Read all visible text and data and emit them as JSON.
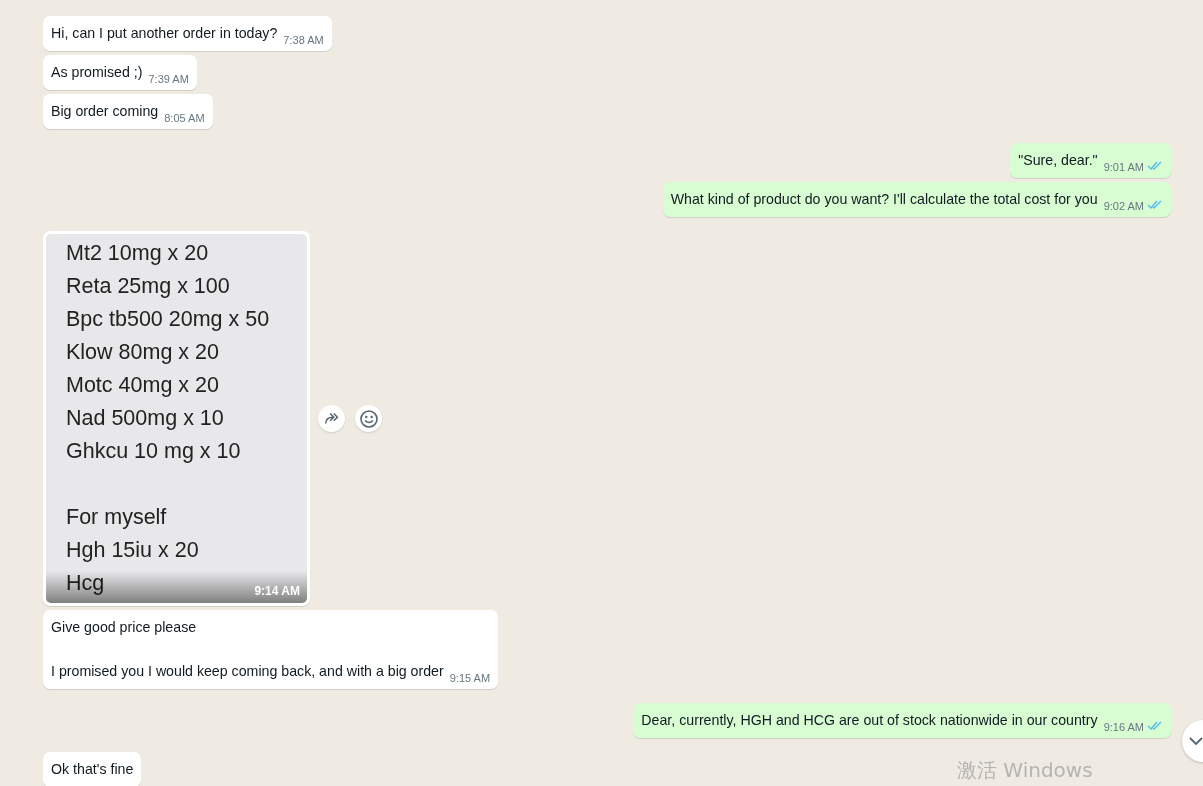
{
  "messages": [
    {
      "outgoing": false,
      "kind": "text",
      "paragraphs": [
        "Hi, can I put another order in today?"
      ],
      "time": "7:38 AM"
    },
    {
      "outgoing": false,
      "kind": "text",
      "paragraphs": [
        "As promised ;)"
      ],
      "time": "7:39 AM"
    },
    {
      "outgoing": false,
      "kind": "text",
      "paragraphs": [
        "Big order coming"
      ],
      "time": "8:05 AM"
    },
    {
      "outgoing": true,
      "kind": "text",
      "paragraphs": [
        "\"Sure, dear.\""
      ],
      "time": "9:01 AM",
      "read": true
    },
    {
      "outgoing": true,
      "kind": "text",
      "paragraphs": [
        "What kind of product do you want? I'll calculate the total cost for you"
      ],
      "time": "9:02 AM",
      "read": true
    },
    {
      "outgoing": false,
      "kind": "image",
      "image_blocks": [
        [
          "Mt2 10mg x 20",
          "Reta 25mg x 100",
          "Bpc tb500 20mg x 50",
          "Klow 80mg x 20",
          "Motc 40mg x 20",
          "Nad 500mg x 10",
          "Ghkcu 10 mg x 10"
        ],
        [
          "For myself",
          "Hgh 15iu x 20",
          "Hcg"
        ]
      ],
      "time": "9:14 AM",
      "hovered": true
    },
    {
      "outgoing": false,
      "kind": "text",
      "paragraphs": [
        "Give good price please",
        "I promised you I would keep coming back, and with a big order"
      ],
      "time": "9:15 AM"
    },
    {
      "outgoing": true,
      "kind": "text",
      "paragraphs": [
        "Dear, currently, HGH and HCG are out of stock nationwide in our country"
      ],
      "time": "9:16 AM",
      "read": true
    },
    {
      "outgoing": false,
      "kind": "text",
      "paragraphs": [
        "Ok that's fine"
      ]
    }
  ],
  "os_watermark": "激活 Windows"
}
